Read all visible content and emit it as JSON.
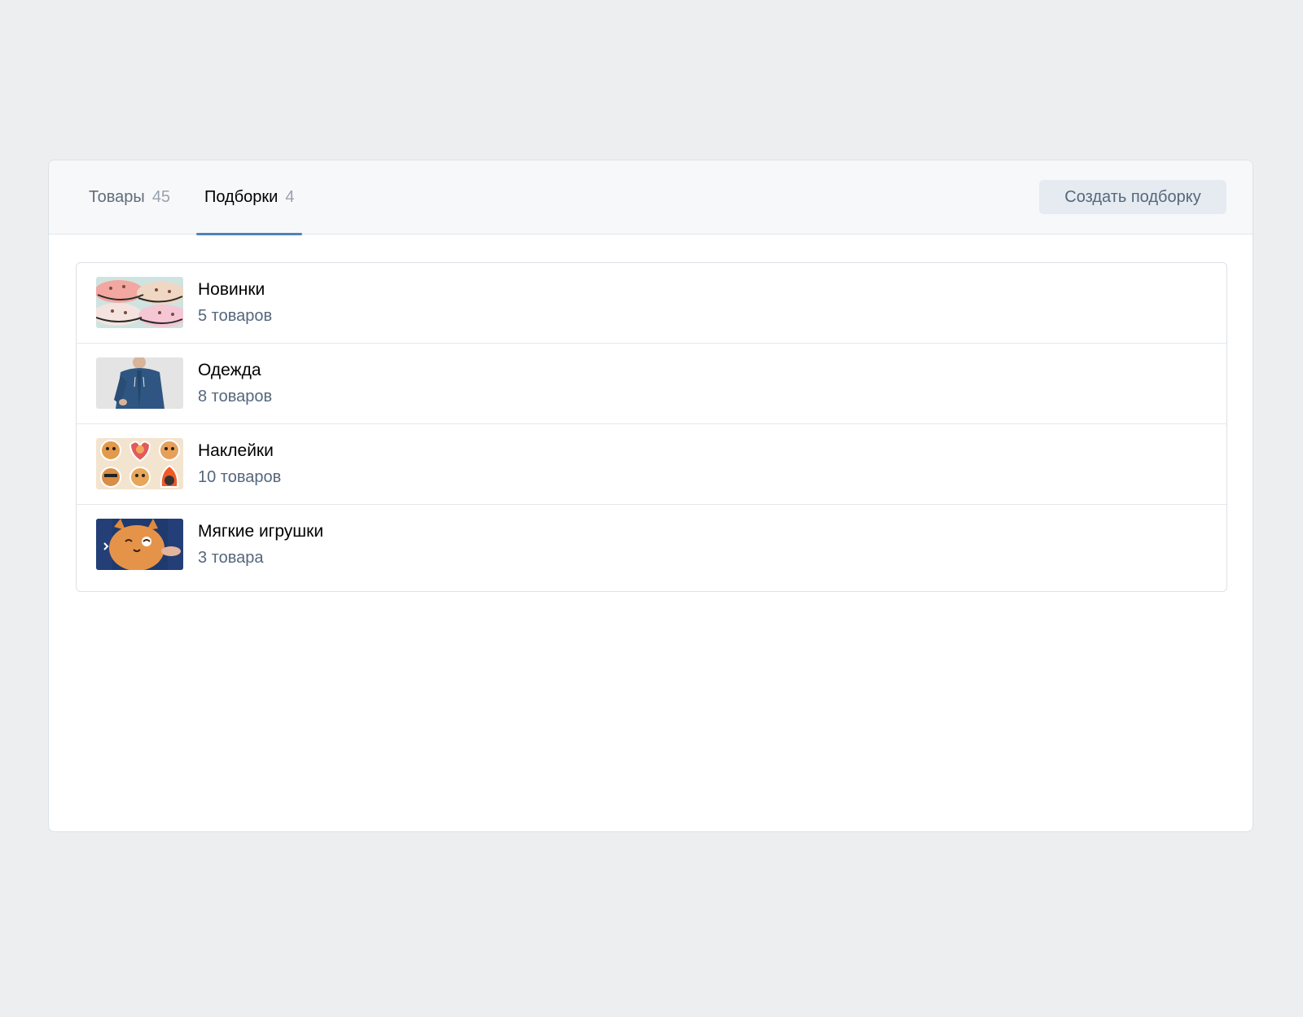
{
  "tabs": {
    "products": {
      "label": "Товары",
      "count": "45"
    },
    "collections": {
      "label": "Подборки",
      "count": "4"
    }
  },
  "create_button_label": "Создать подборку",
  "collections": [
    {
      "title": "Новинки",
      "count": "5 товаров",
      "thumb_icon": "bags-thumbnail"
    },
    {
      "title": "Одежда",
      "count": "8 товаров",
      "thumb_icon": "hoodie-thumbnail"
    },
    {
      "title": "Наклейки",
      "count": "10 товаров",
      "thumb_icon": "stickers-thumbnail"
    },
    {
      "title": "Мягкие игрушки",
      "count": "3 товара",
      "thumb_icon": "plush-toy-thumbnail"
    }
  ],
  "colors": {
    "accent": "#5181b8",
    "background": "#edeef0"
  }
}
